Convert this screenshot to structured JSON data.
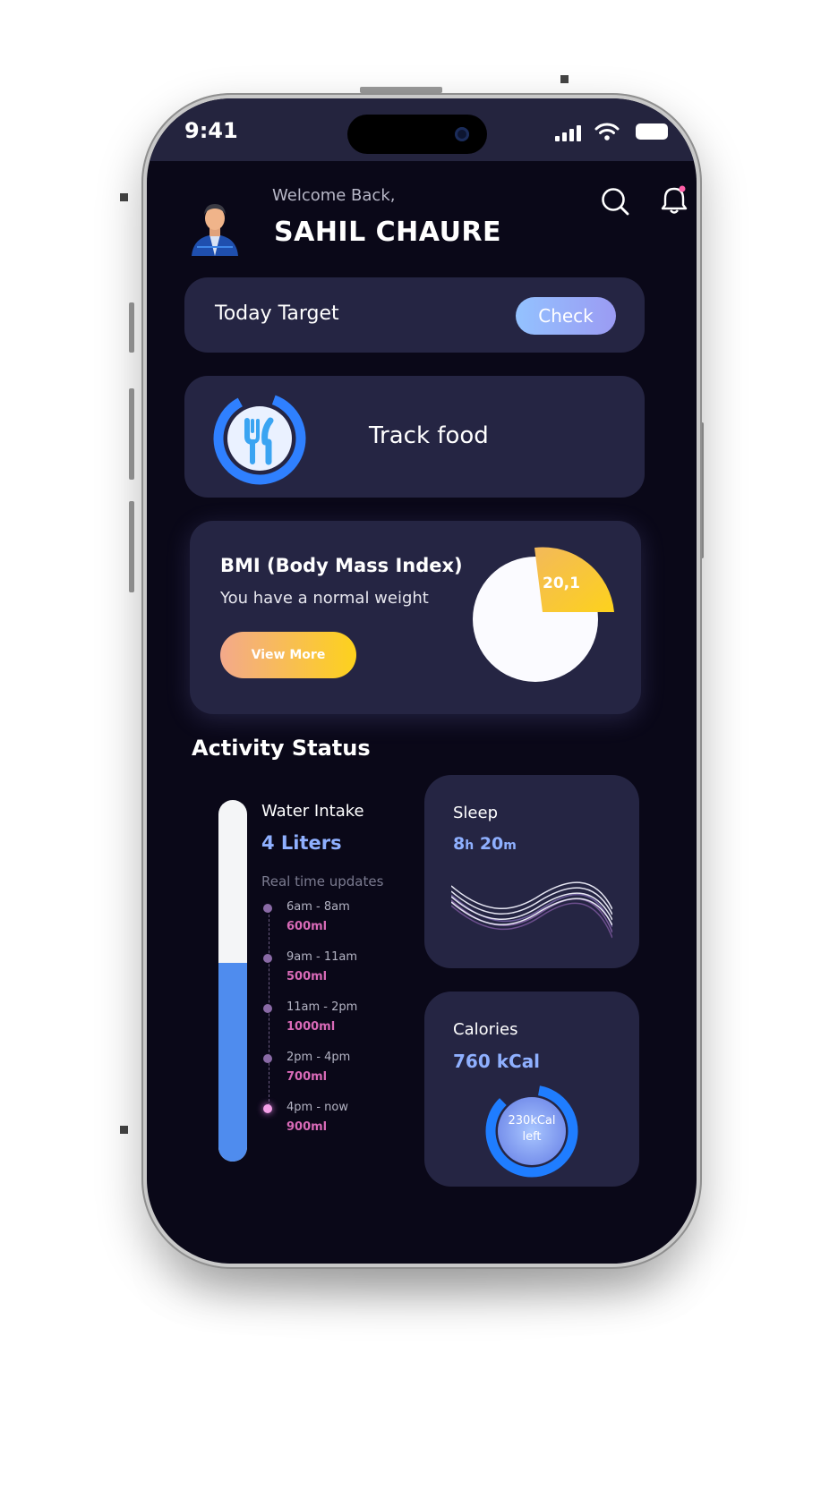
{
  "status_bar": {
    "time": "9:41"
  },
  "header": {
    "welcome": "Welcome Back,",
    "user_name": "SAHIL CHAURE"
  },
  "target": {
    "label": "Today Target",
    "check_label": "Check"
  },
  "food": {
    "label": "Track food"
  },
  "bmi": {
    "title": "BMI (Body Mass Index)",
    "subtitle": "You have a normal weight",
    "view_more_label": "View More",
    "value": "20,1"
  },
  "activity": {
    "title": "Activity Status",
    "water": {
      "title": "Water Intake",
      "value": "4 Liters",
      "fill_fraction": 0.55,
      "updates_label": "Real time updates",
      "entries": [
        {
          "time": "6am - 8am",
          "amount": "600ml"
        },
        {
          "time": "9am - 11am",
          "amount": "500ml"
        },
        {
          "time": "11am - 2pm",
          "amount": "1000ml"
        },
        {
          "time": "2pm - 4pm",
          "amount": "700ml"
        },
        {
          "time": "4pm - now",
          "amount": "900ml"
        }
      ]
    },
    "sleep": {
      "title": "Sleep",
      "hours": "8",
      "h_unit": "h",
      "minutes": "20",
      "m_unit": "m"
    },
    "calories": {
      "title": "Calories",
      "value": "760 kCal",
      "left_value": "230kCal",
      "left_label": "left"
    }
  },
  "colors": {
    "screen_bg": "#0a0818",
    "card_bg": "#252543",
    "accent_blue": "#8fb0ff",
    "water_fill": "#4f8cee",
    "bmi_yellow": "#fdd21c",
    "timeline_pink": "#d86ab7"
  },
  "icons": [
    "signal-icon",
    "wifi-icon",
    "battery-icon",
    "search-icon",
    "bell-icon",
    "fork-knife-icon"
  ]
}
